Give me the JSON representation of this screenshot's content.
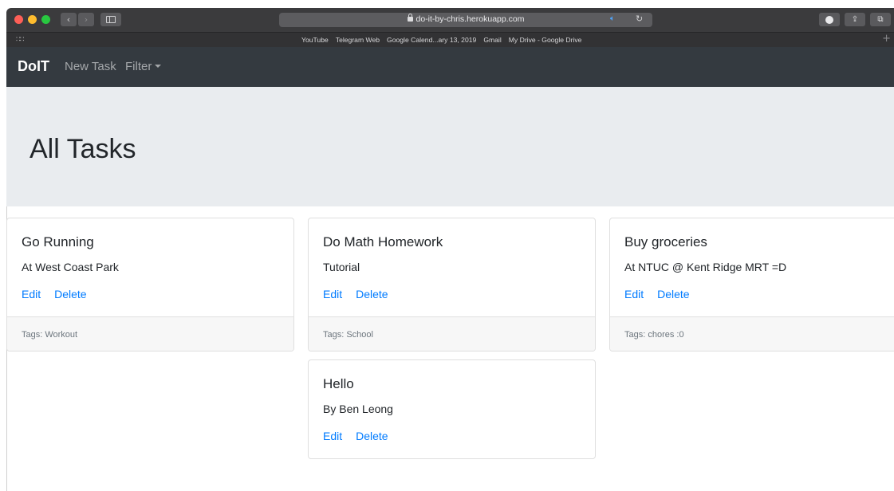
{
  "browser": {
    "url": "do-it-by-chris.herokuapp.com",
    "bookmarks": [
      "YouTube",
      "Telegram Web",
      "Google Calend...ary 13, 2019",
      "Gmail",
      "My Drive - Google Drive"
    ],
    "colors": {
      "close": "#fe5f57",
      "minimize": "#febc2e",
      "zoom": "#28c840"
    },
    "icons": [
      "back-icon",
      "forward-icon",
      "sidebar-icon",
      "lock-icon",
      "speaker-icon",
      "reload-icon",
      "download-icon",
      "share-icon",
      "tabs-icon",
      "apps-grid-icon",
      "new-tab-plus-icon"
    ]
  },
  "navbar": {
    "brand": "DoIT",
    "new_task": "New Task",
    "filter": "Filter"
  },
  "jumbotron": {
    "title": "All Tasks"
  },
  "tasks": [
    {
      "title": "Go Running",
      "description": "At West Coast Park",
      "edit": "Edit",
      "delete": "Delete",
      "tags": "Tags: Workout"
    },
    {
      "title": "Do Math Homework",
      "description": "Tutorial",
      "edit": "Edit",
      "delete": "Delete",
      "tags": "Tags: School"
    },
    {
      "title": "Buy groceries",
      "description": "At NTUC @ Kent Ridge MRT =D",
      "edit": "Edit",
      "delete": "Delete",
      "tags": "Tags: chores :0"
    },
    {
      "title": "Hello",
      "description": "By Ben Leong",
      "edit": "Edit",
      "delete": "Delete"
    }
  ],
  "theme": {
    "link": "#007bff",
    "navbar_bg": "#343a40",
    "jumbotron_bg": "#e9ecef"
  }
}
